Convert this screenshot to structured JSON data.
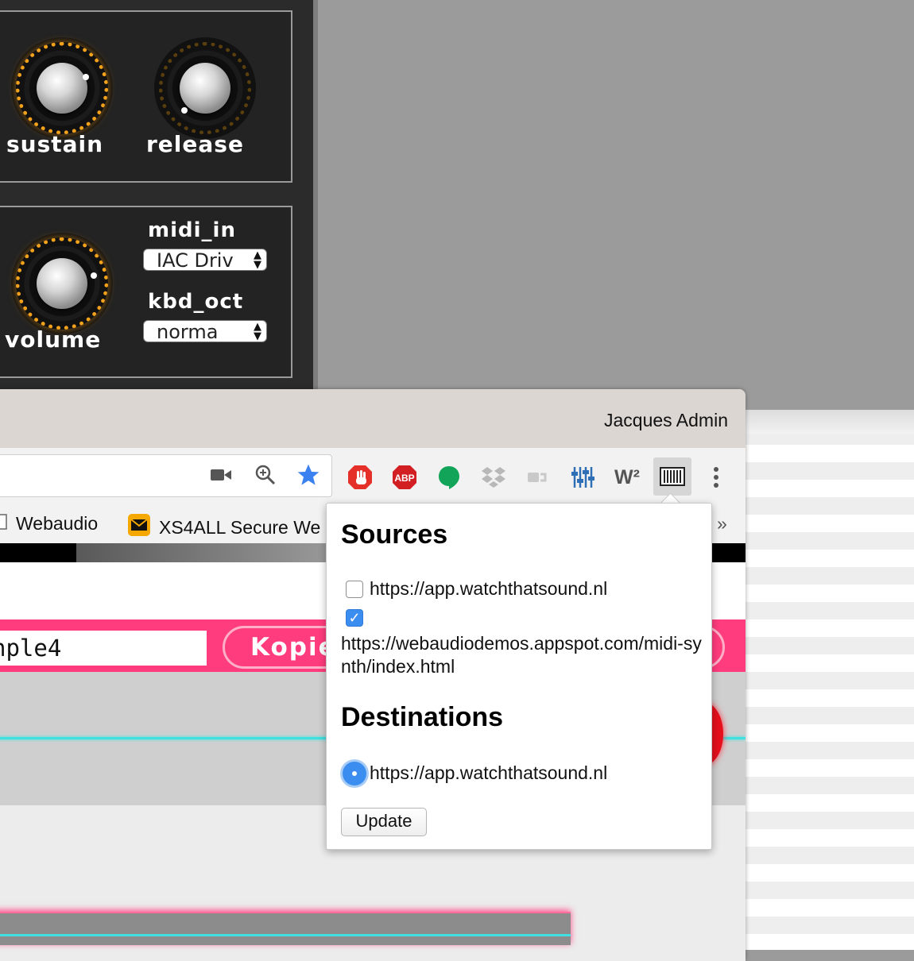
{
  "synth": {
    "knobs": [
      {
        "label": "sustain"
      },
      {
        "label": "release"
      },
      {
        "label": "volume"
      }
    ],
    "midi_in": {
      "label": "midi_in",
      "value": "IAC Driv"
    },
    "kbd_oct": {
      "label": "kbd_oct",
      "value": "norma"
    }
  },
  "browser": {
    "profile_name": "Jacques Admin",
    "extensions": [
      "stop-hand-icon",
      "abp-icon",
      "hangouts-icon",
      "dropbox-icon",
      "cast-icon",
      "equalizer-icon",
      "w2-icon",
      "midi-keyboard-icon",
      "menu-icon"
    ],
    "abp_text": "ABP",
    "w2_text": "W²",
    "bookmarks": [
      {
        "label": "Webaudio",
        "icon": "folder-icon"
      },
      {
        "label": "XS4ALL Secure We",
        "icon": "mail-icon"
      }
    ],
    "bookmarks_overflow": "»"
  },
  "page": {
    "name_input_value": "nple4",
    "kopie_label": "Kopie"
  },
  "popup": {
    "sources_title": "Sources",
    "sources": [
      {
        "url": "https://app.watchthatsound.nl",
        "checked": false
      },
      {
        "url": "https://webaudiodemos.appspot.com/midi-synth/index.html",
        "checked": true
      }
    ],
    "destinations_title": "Destinations",
    "destinations": [
      {
        "url": "https://app.watchthatsound.nl",
        "selected": true
      }
    ],
    "update_label": "Update"
  },
  "colors": {
    "accent_pink": "#ff3c7d",
    "checkbox_blue": "#3b8ef0",
    "knob_amber": "#f4a11b"
  }
}
